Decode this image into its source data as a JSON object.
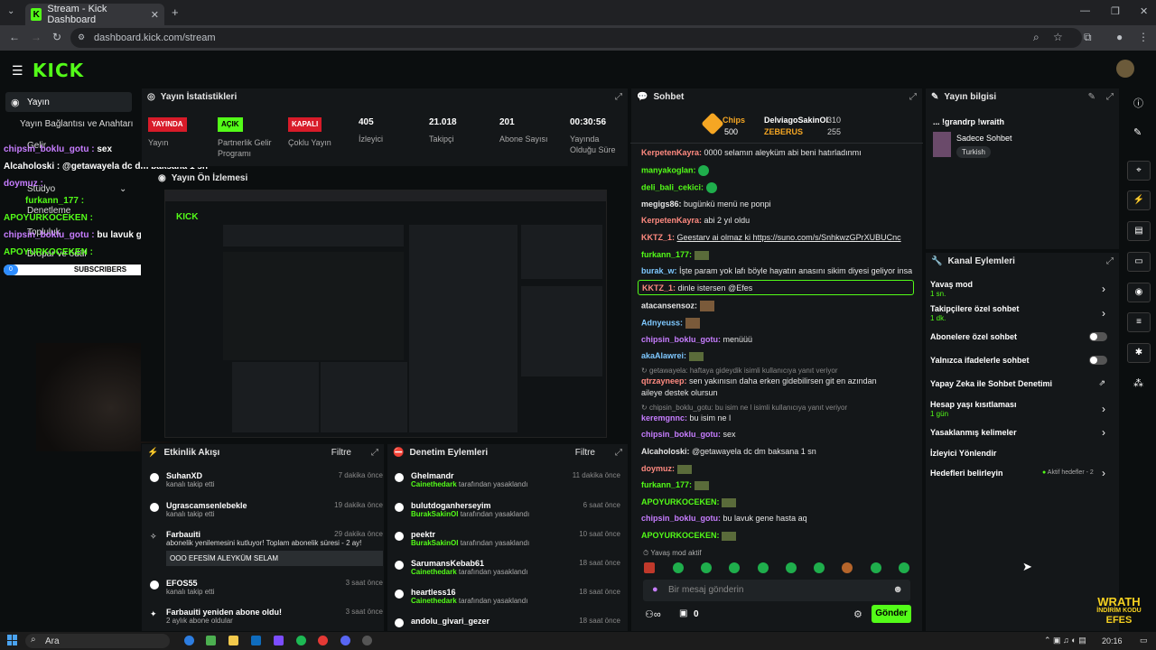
{
  "browser": {
    "tab_title": "Stream - Kick Dashboard",
    "url": "dashboard.kick.com/stream"
  },
  "logo": "KICK",
  "sidebar": {
    "items": [
      "Yayın",
      "Yayın Bağlantısı ve Anahtarı",
      "Gelir",
      "Stüdyo",
      "Denetleme",
      "Topluluk",
      "Dropar ve ödül"
    ]
  },
  "overlay": {
    "lines": [
      {
        "user": "chipsin_boklu_gotu :",
        "msg": "sex",
        "color": "#c77dff"
      },
      {
        "user": "Alcaholoski :",
        "msg": "@getawayela dc dm baksana 1 sn",
        "color": "#ffffff"
      },
      {
        "user": "doymuz :",
        "msg": "",
        "color": "#c77dff"
      },
      {
        "user": "furkann_177 :",
        "msg": "",
        "color": "#53fc18"
      },
      {
        "user": "APOYURKOCEKEN :",
        "msg": "",
        "color": "#53fc18"
      },
      {
        "user": "chipsin_boklu_gotu :",
        "msg": "bu lavuk gene hasta aq",
        "color": "#c77dff"
      },
      {
        "user": "APOYURKOCEKEN :",
        "msg": "",
        "color": "#53fc18"
      }
    ],
    "subscribers": "SUBSCRIBERS",
    "sub_count": "0"
  },
  "stats": {
    "title": "Yayın İstatistikleri",
    "items": [
      {
        "badge": "YAYINDA",
        "label": "Yayın",
        "type": "red"
      },
      {
        "badge": "AÇIK",
        "label": "Partnerlik Gelir Programı",
        "type": "green"
      },
      {
        "badge": "KAPALI",
        "label": "Çoklu Yayın",
        "type": "red"
      },
      {
        "value": "405",
        "label": "İzleyici"
      },
      {
        "value": "21.018",
        "label": "Takipçi"
      },
      {
        "value": "201",
        "label": "Abone Sayısı"
      },
      {
        "value": "00:30:56",
        "label": "Yayında Olduğu Süre"
      }
    ]
  },
  "preview": {
    "title": "Yayın Ön İzlemesi"
  },
  "activity": {
    "title": "Etkinlik Akışı",
    "filter": "Filtre",
    "items": [
      {
        "name": "SuhanXD",
        "sub": "kanalı takip etti",
        "time": "7 dakika önce"
      },
      {
        "name": "Ugrascamsenlebekle",
        "sub": "kanalı takip etti",
        "time": "19 dakika önce"
      },
      {
        "name": "Farbauiti",
        "sub": "abonelik yenilemesini kutluyor! Toplam abonelik süresi - 2 ay!",
        "time": "29 dakika önce",
        "msg": "OOO EFESİM ALEYKÜM SELAM"
      },
      {
        "name": "EFOS55",
        "sub": "kanalı takip etti",
        "time": "3 saat önce"
      },
      {
        "name": "Farbauiti yeniden abone oldu!",
        "sub": "2 aylık abone oldular",
        "time": "3 saat önce"
      }
    ]
  },
  "moderation": {
    "title": "Denetim Eylemleri",
    "filter": "Filtre",
    "items": [
      {
        "name": "Ghelmandr",
        "by": "Cainethedark",
        "suffix": "tarafından yasaklandı",
        "time": "11 dakika önce"
      },
      {
        "name": "bulutdoganherseyim",
        "by": "BurakSakinOl",
        "suffix": "tarafından yasaklandı",
        "time": "6 saat önce"
      },
      {
        "name": "peektr",
        "by": "BurakSakinOl",
        "suffix": "tarafından yasaklandı",
        "time": "10 saat önce"
      },
      {
        "name": "SarumansKebab61",
        "by": "Cainethedark",
        "suffix": "tarafından yasaklandı",
        "time": "18 saat önce"
      },
      {
        "name": "heartless16",
        "by": "Cainethedark",
        "suffix": "tarafından yasaklandı",
        "time": "18 saat önce"
      },
      {
        "name": "andolu_givari_gezer",
        "by": "",
        "suffix": "",
        "time": "18 saat önce"
      }
    ]
  },
  "chat": {
    "title": "Sohbet",
    "leaderboard": {
      "label": "Chips",
      "amount": "500",
      "top1": "DelviagoSakinOl",
      "top1_val": "310",
      "top2": "ZEBERUS",
      "top2_val": "255"
    },
    "messages": [
      {
        "user": "KerpetenKayra:",
        "msg": "0000 selamın aleyküm abi beni hatırladınmı",
        "color": "#ff8a80"
      },
      {
        "user": "manyakoglan:",
        "msg": "",
        "color": "#53fc18"
      },
      {
        "user": "deli_bali_cekici:",
        "msg": "",
        "color": "#53fc18"
      },
      {
        "user": "megigs86:",
        "msg": "bugünkü menü ne ponpi",
        "color": "#ffffff"
      },
      {
        "user": "KerpetenKayra:",
        "msg": "abi 2 yıl oldu",
        "color": "#ff8a80"
      },
      {
        "user": "KKTZ_1:",
        "msg": "Geestarv ai olmaz ki https://suno.com/s/SnhkwzGPrXUBUCnc",
        "color": "#53fc18"
      },
      {
        "user": "furkann_177:",
        "msg": "",
        "color": "#53fc18"
      },
      {
        "user": "burak_w:",
        "msg": "İşte param yok lafı böyle hayatın anasını sikim diyesi geliyor insanın",
        "color": "#7ec8ff"
      },
      {
        "user": "KKTZ_1:",
        "msg": "dinle istersen @Efes",
        "color": "#53fc18"
      },
      {
        "user": "atacansensoz:",
        "msg": "",
        "color": "#ffffff"
      },
      {
        "user": "Adnyeuss:",
        "msg": "",
        "color": "#7ec8ff"
      },
      {
        "user": "chipsin_boklu_gotu:",
        "msg": "menüüü",
        "color": "#c77dff"
      },
      {
        "user": "akaAlawrei:",
        "msg": "",
        "color": "#7ec8ff"
      },
      {
        "user": "",
        "msg": "getawayela: haftaya gideydik isimli kullanıcıya yanıt veriyor",
        "color": "#888888"
      },
      {
        "user": "qtrzayneep:",
        "msg": "sen yakınısın daha erken gidebilirsen git en azından",
        "color": "#ff8a80"
      },
      {
        "user": "",
        "msg": "aileye destek olursun",
        "color": "#ffffff"
      },
      {
        "user": "",
        "msg": "chipsin_boklu_gotu: bu isim ne l isimli kullanıcıya yanıt veriyor",
        "color": "#888888"
      },
      {
        "user": "keremgnnc:",
        "msg": "bu isim ne l",
        "color": "#c77dff"
      },
      {
        "user": "chipsin_boklu_gotu:",
        "msg": "sex",
        "color": "#c77dff"
      },
      {
        "user": "Alcaholoski:",
        "msg": "@getawayela dc dm baksana 1 sn",
        "color": "#ffffff"
      },
      {
        "user": "doymuz:",
        "msg": "",
        "color": "#ff8a80"
      },
      {
        "user": "furkann_177:",
        "msg": "",
        "color": "#53fc18"
      },
      {
        "user": "APOYURKOCEKEN:",
        "msg": "",
        "color": "#53fc18"
      },
      {
        "user": "chipsin_boklu_gotu:",
        "msg": "bu lavuk gene hasta aq",
        "color": "#c77dff"
      },
      {
        "user": "APOYURKOCEKEN:",
        "msg": "",
        "color": "#53fc18"
      }
    ],
    "slow_mode": "Yavaş mod aktif",
    "input_placeholder": "Bir mesaj gönderin",
    "points": "0",
    "send": "Gönder"
  },
  "info": {
    "title": "Yayın bilgisi",
    "stream_title": "... !grandrp !wraith",
    "category": "Sadece Sohbet",
    "tag": "Turkish"
  },
  "actions": {
    "title": "Kanal Eylemleri",
    "items": [
      {
        "label": "Yavaş mod",
        "sub": "1 sn."
      },
      {
        "label": "Takipçilere özel sohbet",
        "sub": "1 dk."
      },
      {
        "label": "Abonelere özel sohbet",
        "sub": ""
      },
      {
        "label": "Yalnızca ifadelerle sohbet",
        "sub": ""
      },
      {
        "label": "Yapay Zeka ile Sohbet Denetimi",
        "sub": ""
      },
      {
        "label": "Hesap yaşı kısıtlaması",
        "sub": "1 gün"
      },
      {
        "label": "Yasaklanmış kelimeler",
        "sub": ""
      },
      {
        "label": "İzleyici Yönlendir",
        "sub": ""
      },
      {
        "label": "Hedefleri belirleyin",
        "sub": "Aktif hedefler - 2"
      }
    ]
  },
  "corner_logo": {
    "line1": "WRATH",
    "line2": "İNDİRİM KODU",
    "line3": "EFES"
  },
  "taskbar": {
    "search": "Ara",
    "time": "20:16"
  },
  "colors": {
    "accent": "#53fc18",
    "panel": "#141719",
    "bg": "#0b0e0f"
  }
}
